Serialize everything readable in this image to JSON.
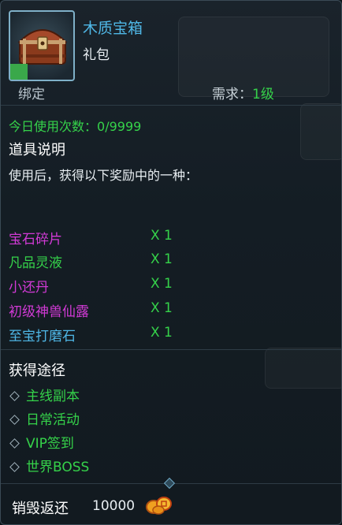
{
  "item": {
    "name": "木质宝箱",
    "type": "礼包",
    "bind": "绑定",
    "requirement_label": "需求：",
    "requirement_value": "1级",
    "icon": "wooden-chest-icon"
  },
  "usage": {
    "label": "今日使用次数：",
    "value": "0/9999"
  },
  "description": {
    "title": "道具说明",
    "text": "使用后，获得以下奖励中的一种："
  },
  "rewards": [
    {
      "name": "宝石碎片",
      "qty": "X 1",
      "color": "#d23ad6"
    },
    {
      "name": "凡品灵液",
      "qty": "X 1",
      "color": "#35d24a"
    },
    {
      "name": "小还丹",
      "qty": "X 1",
      "color": "#d23ad6"
    },
    {
      "name": "初级神兽仙露",
      "qty": "X 1",
      "color": "#d23ad6"
    },
    {
      "name": "至宝打磨石",
      "qty": "X 1",
      "color": "#4fb7e6"
    }
  ],
  "sources": {
    "title": "获得途径",
    "items": [
      "主线副本",
      "日常活动",
      "VIP签到",
      "世界BOSS"
    ]
  },
  "destroy": {
    "label": "销毁返还",
    "value": "10000",
    "icon": "gold-coin-icon"
  },
  "colors": {
    "name_blue": "#4fb7e6",
    "green": "#35d24a",
    "purple": "#d23ad6"
  }
}
